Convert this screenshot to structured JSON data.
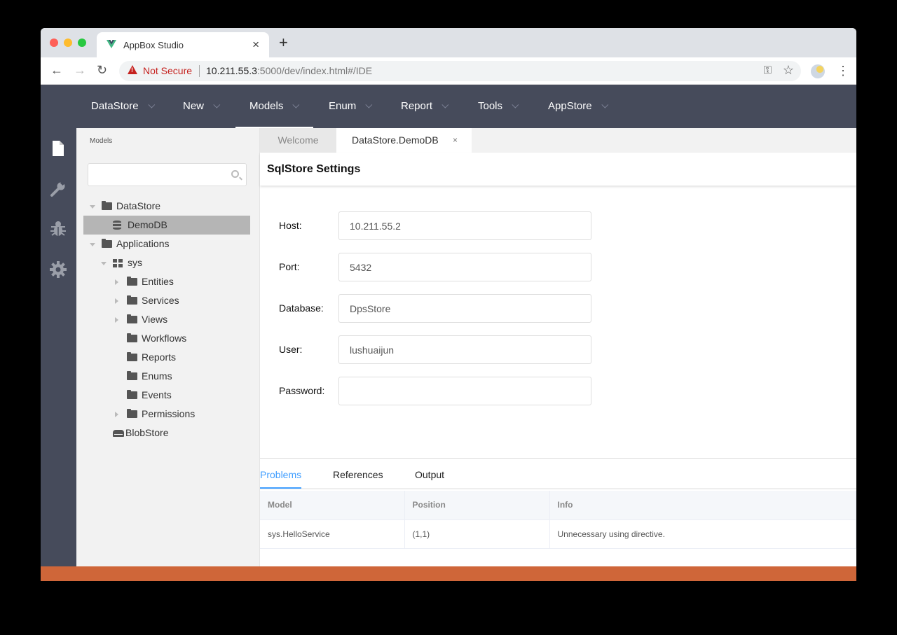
{
  "browser": {
    "tab_title": "AppBox Studio",
    "tab_close": "×",
    "new_tab": "+",
    "security_label": "Not Secure",
    "url_host": "10.211.55.3",
    "url_rest": ":5000/dev/index.html#/IDE",
    "back": "←",
    "forward": "→",
    "reload": "↻",
    "key_icon": "⚿",
    "star_icon": "☆",
    "menu_icon": "⋮"
  },
  "topnav": {
    "items": [
      {
        "label": "DataStore"
      },
      {
        "label": "New"
      },
      {
        "label": "Models",
        "active": true
      },
      {
        "label": "Enum"
      },
      {
        "label": "Report"
      },
      {
        "label": "Tools"
      },
      {
        "label": "AppStore"
      }
    ]
  },
  "iconbar": [
    "file-icon",
    "wrench-icon",
    "bug-icon",
    "gear-icon"
  ],
  "sidebar": {
    "caption": "Models",
    "search_placeholder": "",
    "tree": [
      {
        "label": "DataStore",
        "icon": "folder",
        "level": 0,
        "caret": "down"
      },
      {
        "label": "DemoDB",
        "icon": "database",
        "level": 1,
        "caret": "",
        "selected": true
      },
      {
        "label": "Applications",
        "icon": "folder",
        "level": 0,
        "caret": "down"
      },
      {
        "label": "sys",
        "icon": "app",
        "level": 1,
        "caret": "down"
      },
      {
        "label": "Entities",
        "icon": "folder",
        "level": 2,
        "caret": "right"
      },
      {
        "label": "Services",
        "icon": "folder",
        "level": 2,
        "caret": "right"
      },
      {
        "label": "Views",
        "icon": "folder",
        "level": 2,
        "caret": "right"
      },
      {
        "label": "Workflows",
        "icon": "folder",
        "level": 2,
        "caret": ""
      },
      {
        "label": "Reports",
        "icon": "folder",
        "level": 2,
        "caret": ""
      },
      {
        "label": "Enums",
        "icon": "folder",
        "level": 2,
        "caret": ""
      },
      {
        "label": "Events",
        "icon": "folder",
        "level": 2,
        "caret": ""
      },
      {
        "label": "Permissions",
        "icon": "folder",
        "level": 2,
        "caret": "right"
      },
      {
        "label": "BlobStore",
        "icon": "blobstore",
        "level": 1,
        "caret": ""
      }
    ]
  },
  "editor": {
    "tabs": [
      {
        "label": "Welcome"
      },
      {
        "label": "DataStore.DemoDB",
        "close": "×",
        "active": true
      }
    ],
    "panel_title": "SqlStore Settings",
    "fields": [
      {
        "label": "Host:",
        "value": "10.211.55.2"
      },
      {
        "label": "Port:",
        "value": "5432"
      },
      {
        "label": "Database:",
        "value": "DpsStore"
      },
      {
        "label": "User:",
        "value": "lushuaijun"
      },
      {
        "label": "Password:",
        "value": ""
      }
    ]
  },
  "bottom_panel": {
    "tabs": [
      {
        "label": "Problems",
        "active": true
      },
      {
        "label": "References"
      },
      {
        "label": "Output"
      }
    ],
    "columns": [
      "Model",
      "Position",
      "Info"
    ],
    "rows": [
      [
        "sys.HelloService",
        "(1,1)",
        "Unnecessary using directive."
      ]
    ]
  },
  "colors": {
    "nav_bg": "#464b5b",
    "accent": "#409eff",
    "statusbar": "#cf6639",
    "insecure": "#c5221f"
  }
}
